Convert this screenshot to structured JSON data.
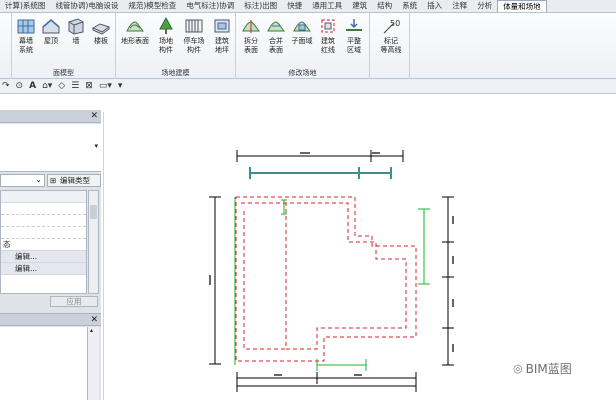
{
  "tabs": [
    "计算)系统图",
    "线管协调)电脑设设",
    "规范)模型检查",
    "电气标注)协调",
    "标注)出图",
    "快捷",
    "通用工具",
    "建筑",
    "结构",
    "系统",
    "插入",
    "注释",
    "分析",
    "体量和场地"
  ],
  "active_tab": "体量和场地",
  "ribbon": {
    "model_group": {
      "title": "面模型",
      "buttons": [
        {
          "label1": "幕墙",
          "label2": "系统",
          "icon": "curtain-system-icon"
        },
        {
          "label1": "屋顶",
          "label2": "",
          "icon": "roof-icon"
        },
        {
          "label1": "墙",
          "label2": "",
          "icon": "wall-icon"
        },
        {
          "label1": "楼板",
          "label2": "",
          "icon": "floor-icon"
        }
      ]
    },
    "site_group": {
      "title": "场地建模",
      "buttons": [
        {
          "label1": "地形表面",
          "label2": "",
          "icon": "toposurface-icon"
        },
        {
          "label1": "场地",
          "label2": "构件",
          "icon": "site-component-icon"
        },
        {
          "label1": "停车场",
          "label2": "构件",
          "icon": "parking-component-icon"
        },
        {
          "label1": "建筑",
          "label2": "地坪",
          "icon": "building-pad-icon"
        }
      ]
    },
    "modify_group": {
      "title": "修改场地",
      "buttons": [
        {
          "label1": "拆分",
          "label2": "表面",
          "icon": "split-surface-icon"
        },
        {
          "label1": "合并",
          "label2": "表面",
          "icon": "merge-surface-icon"
        },
        {
          "label1": "子面域",
          "label2": "",
          "icon": "subregion-icon"
        },
        {
          "label1": "建筑",
          "label2": "红线",
          "icon": "property-line-icon"
        },
        {
          "label1": "平整",
          "label2": "区域",
          "icon": "graded-region-icon"
        }
      ]
    },
    "contour_group": {
      "buttons": [
        {
          "label1": "标记",
          "label2": "等高线",
          "icon": "label-contours-icon",
          "badge": "50"
        }
      ]
    }
  },
  "qat": {
    "text_tool": "A"
  },
  "properties": {
    "edit_type": "编辑类型",
    "state_label": "态",
    "edit_btn_1": "编辑...",
    "edit_btn_2": "编辑...",
    "apply": "应用"
  },
  "watermark": "BIM蓝图",
  "colors": {
    "dim_line": "#000000",
    "red_dash": "#d9262e",
    "green": "#17b52d",
    "teal": "#3a8f8a"
  }
}
